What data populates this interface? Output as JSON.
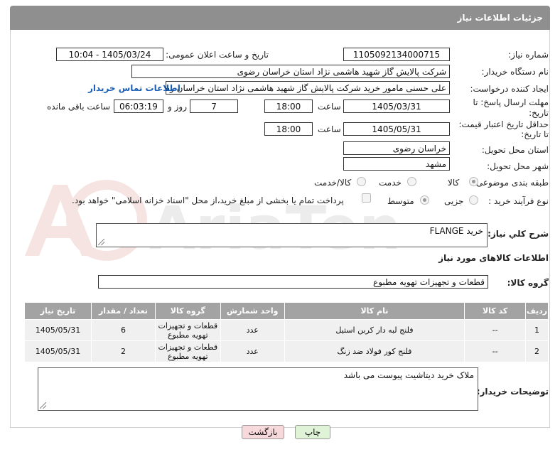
{
  "page": {
    "title": "جزئیات اطلاعات نیاز"
  },
  "fields": {
    "need_number_label": "شماره نیاز:",
    "need_number": "1105092134000715",
    "announce_label": "تاریخ و ساعت اعلان عمومی:",
    "announce_value": "1405/03/24 - 10:04",
    "buyer_org_label": "نام دستگاه خریدار:",
    "buyer_org": "شرکت پالایش گاز شهید هاشمی نژاد   استان خراسان رضوی",
    "creator_label": "ایجاد کننده درخواست:",
    "creator": "علی حسنی مامور خرید شرکت پالایش گاز شهید هاشمی نژاد   استان خراسان رضوی",
    "contact_link": "اطلاعات تماس خریدار",
    "deadline_label_1": "مهلت ارسال پاسخ: تا",
    "deadline_label_2": "تاریخ:",
    "deadline_date": "1405/03/31",
    "time_label": "ساعت",
    "deadline_time": "18:00",
    "days_value": "7",
    "days_label": "روز و",
    "remaining_time": "06:03:19",
    "remaining_label": "ساعت باقی مانده",
    "validity_label_1": "حداقل تاریخ اعتبار قیمت:",
    "validity_label_2": "تا تاریخ:",
    "validity_date": "1405/05/31",
    "validity_time": "18:00",
    "province_label": "استان محل تحویل:",
    "province": "خراسان رضوی",
    "city_label": "شهر محل تحویل:",
    "city": "مشهد",
    "category_label": "طبقه بندی موضوعی:",
    "category_options": [
      "کالا",
      "خدمت",
      "کالا/خدمت"
    ],
    "purchase_type_label": "نوع فرآیند خرید :",
    "purchase_options": [
      "جزیی",
      "متوسط"
    ],
    "payment_note": "پرداخت تمام یا بخشی از مبلغ خرید،از محل \"اسناد خزانه اسلامی\" خواهد بود.",
    "description_label": "شرح کلي نياز:",
    "description": "خرید FLANGE",
    "goods_info_title": "اطلاعات کالاهای مورد نیاز",
    "goods_group_label": "گروه کالا:",
    "goods_group": "قطعات و تجهیزات تهویه مطبوع",
    "buyer_notes_label": "توضیحات خریدار:",
    "buyer_notes": "ملاک خرید دیتاشیت پیوست می باشد"
  },
  "table": {
    "headers": [
      "ردیف",
      "کد کالا",
      "نام کالا",
      "واحد شمارش",
      "گروه کالا",
      "تعداد / مقدار",
      "تاریخ نیاز"
    ],
    "rows": [
      [
        "1",
        "--",
        "فلنج لبه دار کربن استیل",
        "عدد",
        "قطعات و تجهیزات تهویه مطبوع",
        "6",
        "1405/05/31"
      ],
      [
        "2",
        "--",
        "فلنج کور فولاد ضد زنگ",
        "عدد",
        "قطعات و تجهیزات تهویه مطبوع",
        "2",
        "1405/05/31"
      ]
    ]
  },
  "buttons": {
    "print": "چاپ",
    "back": "بازگشت"
  },
  "watermark": {
    "text": "AriaTender.neT"
  },
  "colors": {
    "title_bg": "#8f8f8f",
    "table_header": "#a3a3a3",
    "link": "#1a5fb4",
    "back_button": "#f7d9dc",
    "print_button": "#dff3d6"
  }
}
